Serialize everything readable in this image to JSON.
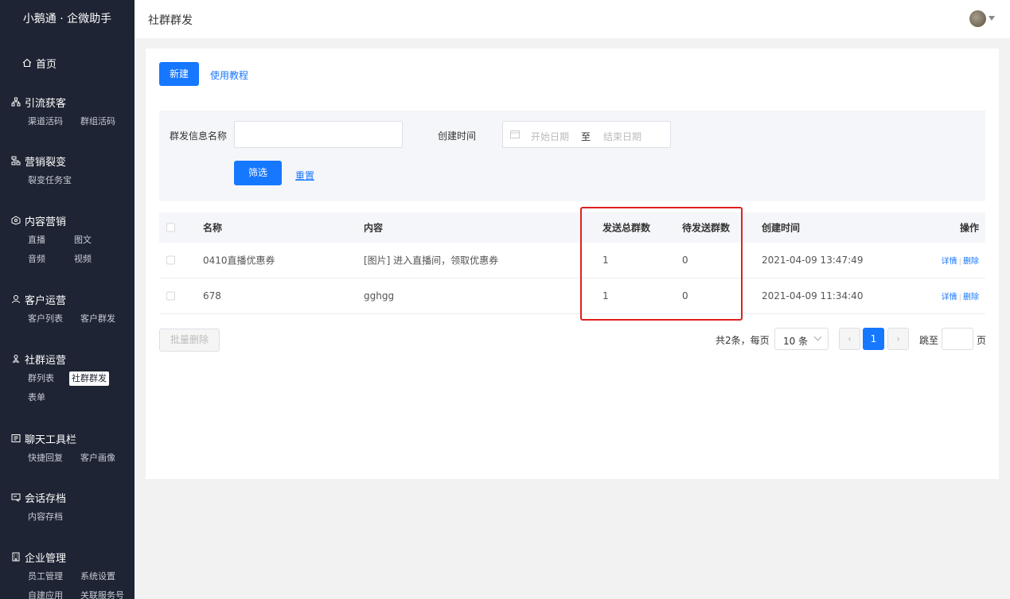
{
  "brand": "小鹅通 · 企微助手",
  "header": {
    "title": "社群群发"
  },
  "sidebar": [
    {
      "title": "首页",
      "icon": "home-icon",
      "items": []
    },
    {
      "title": "引流获客",
      "icon": "network-icon",
      "items": [
        "渠道活码",
        "群组活码"
      ]
    },
    {
      "title": "营销裂变",
      "icon": "sitemap-icon",
      "items": [
        "裂变任务宝"
      ]
    },
    {
      "title": "内容营销",
      "icon": "content-icon",
      "items": [
        "直播",
        "图文",
        "音频",
        "视频"
      ]
    },
    {
      "title": "客户运营",
      "icon": "user-icon",
      "items": [
        "客户列表",
        "客户群发"
      ]
    },
    {
      "title": "社群运营",
      "icon": "group-icon",
      "items": [
        "群列表",
        "社群群发",
        "表单"
      ],
      "active": "社群群发"
    },
    {
      "title": "聊天工具栏",
      "icon": "toolbar-icon",
      "items": [
        "快捷回复",
        "客户画像"
      ]
    },
    {
      "title": "会话存档",
      "icon": "archive-icon",
      "items": [
        "内容存档"
      ]
    },
    {
      "title": "企业管理",
      "icon": "building-icon",
      "items": [
        "员工管理",
        "系统设置",
        "自建应用",
        "关联服务号"
      ]
    }
  ],
  "toolbar": {
    "new_label": "新建",
    "tutorial_label": "使用教程"
  },
  "filter": {
    "name_label": "群发信息名称",
    "name_value": "",
    "time_label": "创建时间",
    "start_placeholder": "开始日期",
    "range_sep": "至",
    "end_placeholder": "结束日期",
    "filter_label": "筛选",
    "reset_label": "重置"
  },
  "table": {
    "columns": [
      "名称",
      "内容",
      "发送总群数",
      "待发送群数",
      "创建时间",
      "操作"
    ],
    "rows": [
      {
        "name": "0410直播优惠券",
        "content": "[图片] 进入直播间，领取优惠券",
        "total": "1",
        "pending": "0",
        "time": "2021-04-09 13:47:49"
      },
      {
        "name": "678",
        "content": "gghgg",
        "total": "1",
        "pending": "0",
        "time": "2021-04-09 11:34:40"
      }
    ],
    "op_detail": "详情",
    "op_delete": "删除"
  },
  "footer": {
    "batch_delete": "批量删除",
    "total_text": "共2条，每页",
    "page_size": "10 条",
    "current_page": "1",
    "jump_label": "跳至",
    "jump_unit": "页"
  },
  "colors": {
    "primary": "#1677ff",
    "sidebar_bg": "#1e2433",
    "highlight": "#e02020"
  }
}
